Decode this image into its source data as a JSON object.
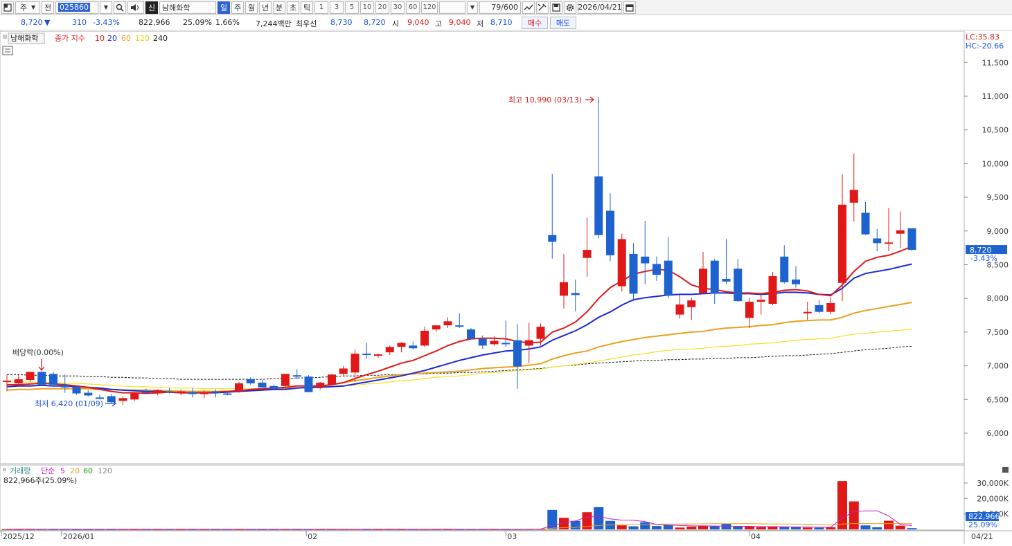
{
  "toolbar": {
    "stock_type": "주",
    "prev_label": "전",
    "code": "025860",
    "market_badge": "신",
    "name": "남해화학",
    "periods": [
      "일",
      "주",
      "월",
      "년",
      "분",
      "초",
      "틱"
    ],
    "active_period": "일",
    "intervals": [
      "1",
      "3",
      "5",
      "10",
      "20",
      "30",
      "60",
      "120"
    ],
    "count": "79/600",
    "date": "2026/04/21",
    "icons": [
      "window-icon",
      "search-icon",
      "speaker-icon",
      "compare-icon",
      "tools-icon",
      "save-icon",
      "gear-icon",
      "calendar-icon"
    ]
  },
  "quote": {
    "price": "8,720",
    "direction_arrow": "▼",
    "change": "310",
    "change_rate": "-3.43%",
    "volume": "822,966",
    "volume_rate": "25.09%",
    "turnover": "1.66%",
    "amount": "7,244백만",
    "best_ask_label": "최우선",
    "best_ask": "8,730",
    "best_bid": "8,720",
    "open_label": "시",
    "open": "9,040",
    "high_label": "고",
    "high": "9,040",
    "low_label": "저",
    "low": "8,710",
    "buy_label": "매수",
    "sell_label": "매도"
  },
  "price_panel": {
    "name_label": "남해화학",
    "indicator_label": "종가 지수",
    "ma_labels": [
      "10",
      "20",
      "60",
      "120",
      "240"
    ],
    "ma_colors": [
      "#e01818",
      "#1a28d0",
      "#e8a020",
      "#f5e020",
      "#111111"
    ],
    "lc": "LC:35.83",
    "hc": "HC:-20.66",
    "current_price_tag": "8,720",
    "current_change_tag": "-3.43%",
    "high_annotation": "최고 10,990 (03/13)",
    "low_annotation": "최저 6,420 (01/09)",
    "dividend_annotation": "배당락(0.00%)",
    "up_color": "#e01818",
    "down_color": "#1e62d0"
  },
  "volume_panel": {
    "title": "거래량",
    "ma_label": "단순",
    "ma_periods": [
      "5",
      "20",
      "60",
      "120"
    ],
    "ma_colors": [
      "#c020c0",
      "#e8a020",
      "#20a020",
      "#888888"
    ],
    "info": "822,966주(25.09%)",
    "current_volume_tag": "822,966",
    "current_rate_tag": "25.09%"
  },
  "x_axis": {
    "labels": [
      "2025/12",
      "2026/01",
      "02",
      "03",
      "04",
      "04/21"
    ]
  },
  "chart_data": {
    "type": "candlestick",
    "price_axis": {
      "ticks": [
        6000,
        6500,
        7000,
        7500,
        8000,
        8500,
        9000,
        9500,
        10000,
        10500,
        11000,
        11500
      ],
      "tick_labels": [
        "6,000",
        "6,500",
        "7,000",
        "7,500",
        "8,000",
        "8,500",
        "9,000",
        "9,500",
        "10,000",
        "10,500",
        "11,000",
        "11,500"
      ]
    },
    "volume_axis": {
      "ticks": [
        10000,
        20000,
        30000
      ],
      "tick_labels": [
        "10,000K",
        "20,000K",
        "30,000K"
      ]
    },
    "candles": [
      {
        "o": 6760,
        "h": 6870,
        "l": 6620,
        "c": 6780
      },
      {
        "o": 6740,
        "h": 6880,
        "l": 6700,
        "c": 6800
      },
      {
        "o": 6790,
        "h": 6900,
        "l": 6760,
        "c": 6910
      },
      {
        "o": 6910,
        "h": 6920,
        "l": 6700,
        "c": 6720
      },
      {
        "o": 6880,
        "h": 6910,
        "l": 6700,
        "c": 6720
      },
      {
        "o": 6720,
        "h": 6870,
        "l": 6600,
        "c": 6680
      },
      {
        "o": 6690,
        "h": 6700,
        "l": 6570,
        "c": 6590
      },
      {
        "o": 6600,
        "h": 6640,
        "l": 6540,
        "c": 6560
      },
      {
        "o": 6530,
        "h": 6570,
        "l": 6500,
        "c": 6520
      },
      {
        "o": 6550,
        "h": 6580,
        "l": 6440,
        "c": 6460
      },
      {
        "o": 6480,
        "h": 6540,
        "l": 6420,
        "c": 6520
      },
      {
        "o": 6500,
        "h": 6600,
        "l": 6480,
        "c": 6600
      },
      {
        "o": 6620,
        "h": 6660,
        "l": 6580,
        "c": 6600
      },
      {
        "o": 6590,
        "h": 6650,
        "l": 6560,
        "c": 6640
      },
      {
        "o": 6620,
        "h": 6670,
        "l": 6590,
        "c": 6610
      },
      {
        "o": 6600,
        "h": 6650,
        "l": 6560,
        "c": 6620
      },
      {
        "o": 6610,
        "h": 6670,
        "l": 6530,
        "c": 6580
      },
      {
        "o": 6580,
        "h": 6640,
        "l": 6520,
        "c": 6610
      },
      {
        "o": 6620,
        "h": 6650,
        "l": 6530,
        "c": 6600
      },
      {
        "o": 6590,
        "h": 6620,
        "l": 6560,
        "c": 6580
      },
      {
        "o": 6620,
        "h": 6760,
        "l": 6600,
        "c": 6740
      },
      {
        "o": 6800,
        "h": 6830,
        "l": 6720,
        "c": 6740
      },
      {
        "o": 6750,
        "h": 6790,
        "l": 6650,
        "c": 6680
      },
      {
        "o": 6700,
        "h": 6720,
        "l": 6640,
        "c": 6660
      },
      {
        "o": 6700,
        "h": 6880,
        "l": 6690,
        "c": 6880
      },
      {
        "o": 6860,
        "h": 6950,
        "l": 6800,
        "c": 6840
      },
      {
        "o": 6840,
        "h": 6860,
        "l": 6610,
        "c": 6610
      },
      {
        "o": 6680,
        "h": 6760,
        "l": 6650,
        "c": 6750
      },
      {
        "o": 6720,
        "h": 6880,
        "l": 6710,
        "c": 6870
      },
      {
        "o": 6880,
        "h": 7000,
        "l": 6860,
        "c": 6960
      },
      {
        "o": 6900,
        "h": 7240,
        "l": 6760,
        "c": 7180
      },
      {
        "o": 7180,
        "h": 7340,
        "l": 7100,
        "c": 7160
      },
      {
        "o": 7160,
        "h": 7180,
        "l": 7120,
        "c": 7170
      },
      {
        "o": 7200,
        "h": 7300,
        "l": 7160,
        "c": 7280
      },
      {
        "o": 7280,
        "h": 7350,
        "l": 7200,
        "c": 7340
      },
      {
        "o": 7300,
        "h": 7360,
        "l": 7240,
        "c": 7260
      },
      {
        "o": 7300,
        "h": 7580,
        "l": 7280,
        "c": 7520
      },
      {
        "o": 7540,
        "h": 7600,
        "l": 7500,
        "c": 7600
      },
      {
        "o": 7600,
        "h": 7720,
        "l": 7560,
        "c": 7660
      },
      {
        "o": 7600,
        "h": 7780,
        "l": 7560,
        "c": 7580
      },
      {
        "o": 7540,
        "h": 7560,
        "l": 7390,
        "c": 7400
      },
      {
        "o": 7400,
        "h": 7450,
        "l": 7250,
        "c": 7300
      },
      {
        "o": 7320,
        "h": 7440,
        "l": 7300,
        "c": 7370
      },
      {
        "o": 7340,
        "h": 7670,
        "l": 7280,
        "c": 7320
      },
      {
        "o": 7380,
        "h": 7620,
        "l": 6660,
        "c": 6990
      },
      {
        "o": 7300,
        "h": 7640,
        "l": 7040,
        "c": 7380
      },
      {
        "o": 7400,
        "h": 7630,
        "l": 7300,
        "c": 7580
      },
      {
        "o": 8940,
        "h": 9850,
        "l": 8590,
        "c": 8840
      },
      {
        "o": 8040,
        "h": 8660,
        "l": 7850,
        "c": 8240
      },
      {
        "o": 8080,
        "h": 8280,
        "l": 7810,
        "c": 8050
      },
      {
        "o": 8600,
        "h": 9200,
        "l": 8320,
        "c": 8720
      },
      {
        "o": 9810,
        "h": 10990,
        "l": 8890,
        "c": 8940
      },
      {
        "o": 9300,
        "h": 9560,
        "l": 8550,
        "c": 8640
      },
      {
        "o": 8180,
        "h": 8960,
        "l": 8100,
        "c": 8880
      },
      {
        "o": 8660,
        "h": 8820,
        "l": 7960,
        "c": 8070
      },
      {
        "o": 8620,
        "h": 9150,
        "l": 8210,
        "c": 8520
      },
      {
        "o": 8510,
        "h": 8620,
        "l": 8260,
        "c": 8350
      },
      {
        "o": 8560,
        "h": 8910,
        "l": 8000,
        "c": 8040
      },
      {
        "o": 7760,
        "h": 8050,
        "l": 7700,
        "c": 7910
      },
      {
        "o": 7870,
        "h": 8010,
        "l": 7680,
        "c": 7970
      },
      {
        "o": 8080,
        "h": 8690,
        "l": 8070,
        "c": 8440
      },
      {
        "o": 8560,
        "h": 8590,
        "l": 7920,
        "c": 8070
      },
      {
        "o": 8290,
        "h": 8880,
        "l": 8210,
        "c": 8250
      },
      {
        "o": 8440,
        "h": 8580,
        "l": 7950,
        "c": 7960
      },
      {
        "o": 7710,
        "h": 8010,
        "l": 7560,
        "c": 7950
      },
      {
        "o": 7950,
        "h": 8050,
        "l": 7760,
        "c": 7980
      },
      {
        "o": 7920,
        "h": 8390,
        "l": 7900,
        "c": 8330
      },
      {
        "o": 8620,
        "h": 8790,
        "l": 8220,
        "c": 8240
      },
      {
        "o": 8280,
        "h": 8480,
        "l": 8160,
        "c": 8210
      },
      {
        "o": 7800,
        "h": 7950,
        "l": 7680,
        "c": 7800
      },
      {
        "o": 7900,
        "h": 7980,
        "l": 7780,
        "c": 7800
      },
      {
        "o": 7800,
        "h": 8020,
        "l": 7760,
        "c": 7930
      },
      {
        "o": 8230,
        "h": 9840,
        "l": 7960,
        "c": 9390
      },
      {
        "o": 9420,
        "h": 10150,
        "l": 9140,
        "c": 9610
      },
      {
        "o": 9270,
        "h": 9430,
        "l": 8940,
        "c": 8950
      },
      {
        "o": 8890,
        "h": 9030,
        "l": 8700,
        "c": 8820
      },
      {
        "o": 8820,
        "h": 9340,
        "l": 8700,
        "c": 8830
      },
      {
        "o": 8960,
        "h": 9290,
        "l": 8750,
        "c": 9010
      },
      {
        "o": 9040,
        "h": 9040,
        "l": 8710,
        "c": 8720
      }
    ],
    "ma10": [
      6720,
      6720,
      6730,
      6740,
      6730,
      6720,
      6700,
      6680,
      6650,
      6620,
      6600,
      6600,
      6590,
      6600,
      6610,
      6600,
      6600,
      6600,
      6610,
      6620,
      6630,
      6650,
      6660,
      6670,
      6680,
      6700,
      6700,
      6700,
      6720,
      6750,
      6810,
      6870,
      6920,
      6980,
      7040,
      7080,
      7150,
      7220,
      7300,
      7360,
      7400,
      7410,
      7410,
      7400,
      7360,
      7340,
      7350,
      7500,
      7560,
      7650,
      7800,
      8000,
      8160,
      8260,
      8360,
      8400,
      8430,
      8420,
      8320,
      8200,
      8150,
      8130,
      8100,
      8080,
      8080,
      8070,
      8090,
      8120,
      8130,
      8110,
      8060,
      8040,
      8200,
      8400,
      8550,
      8610,
      8640,
      8700,
      8770
    ],
    "ma20": [
      6690,
      6700,
      6700,
      6710,
      6700,
      6700,
      6690,
      6680,
      6670,
      6650,
      6640,
      6630,
      6620,
      6620,
      6610,
      6600,
      6600,
      6600,
      6600,
      6610,
      6620,
      6630,
      6640,
      6650,
      6650,
      6670,
      6680,
      6680,
      6690,
      6700,
      6730,
      6760,
      6790,
      6820,
      6850,
      6890,
      6930,
      6980,
      7030,
      7080,
      7120,
      7160,
      7190,
      7220,
      7230,
      7250,
      7280,
      7380,
      7450,
      7520,
      7610,
      7720,
      7800,
      7900,
      7980,
      8010,
      8030,
      8050,
      8060,
      8060,
      8070,
      8080,
      8080,
      8070,
      8070,
      8060,
      8070,
      8090,
      8090,
      8080,
      8060,
      8050,
      8150,
      8300,
      8370,
      8400,
      8430,
      8470,
      8510
    ],
    "ma60": [
      6640,
      6650,
      6650,
      6660,
      6660,
      6660,
      6660,
      6660,
      6650,
      6650,
      6640,
      6640,
      6640,
      6630,
      6630,
      6620,
      6620,
      6620,
      6620,
      6620,
      6630,
      6630,
      6640,
      6650,
      6660,
      6670,
      6680,
      6690,
      6720,
      6750,
      6780,
      6800,
      6830,
      6850,
      6870,
      6880,
      6890,
      6900,
      6910,
      6920,
      6940,
      6960,
      6970,
      6980,
      6990,
      7010,
      7030,
      7100,
      7150,
      7190,
      7220,
      7280,
      7320,
      7360,
      7390,
      7420,
      7440,
      7460,
      7480,
      7500,
      7510,
      7540,
      7560,
      7570,
      7580,
      7600,
      7610,
      7640,
      7660,
      7670,
      7680,
      7680,
      7720,
      7780,
      7820,
      7850,
      7880,
      7910,
      7940
    ],
    "ma120": [
      6760,
      6760,
      6760,
      6750,
      6750,
      6740,
      6740,
      6730,
      6720,
      6710,
      6700,
      6690,
      6690,
      6680,
      6670,
      6670,
      6670,
      6660,
      6660,
      6660,
      6660,
      6660,
      6660,
      6670,
      6670,
      6670,
      6680,
      6680,
      6690,
      6700,
      6710,
      6730,
      6740,
      6760,
      6780,
      6790,
      6810,
      6830,
      6840,
      6850,
      6870,
      6890,
      6900,
      6910,
      6930,
      6940,
      6950,
      6980,
      7000,
      7020,
      7040,
      7070,
      7100,
      7130,
      7160,
      7180,
      7210,
      7230,
      7240,
      7250,
      7260,
      7280,
      7290,
      7300,
      7320,
      7330,
      7340,
      7360,
      7380,
      7390,
      7400,
      7410,
      7440,
      7470,
      7480,
      7500,
      7510,
      7530,
      7540
    ],
    "ma240": [
      6870,
      6870,
      6860,
      6860,
      6850,
      6850,
      6850,
      6840,
      6840,
      6830,
      6830,
      6820,
      6820,
      6810,
      6810,
      6800,
      6800,
      6800,
      6800,
      6800,
      6800,
      6800,
      6800,
      6810,
      6810,
      6820,
      6820,
      6830,
      6840,
      6850,
      6850,
      6860,
      6860,
      6870,
      6870,
      6880,
      6880,
      6890,
      6890,
      6900,
      6900,
      6910,
      6920,
      6930,
      6940,
      6950,
      6960,
      6980,
      7000,
      7010,
      7030,
      7040,
      7050,
      7060,
      7070,
      7080,
      7080,
      7090,
      7090,
      7100,
      7100,
      7110,
      7110,
      7120,
      7120,
      7130,
      7140,
      7150,
      7150,
      7160,
      7170,
      7180,
      7200,
      7220,
      7240,
      7250,
      7260,
      7280,
      7290
    ],
    "volumes": [
      200,
      150,
      180,
      200,
      150,
      150,
      120,
      100,
      120,
      110,
      130,
      100,
      100,
      100,
      100,
      100,
      80,
      90,
      90,
      80,
      100,
      110,
      90,
      80,
      120,
      110,
      120,
      110,
      120,
      150,
      200,
      100,
      100,
      120,
      100,
      100,
      150,
      110,
      100,
      100,
      120,
      120,
      120,
      130,
      200,
      200,
      250,
      12600,
      7500,
      5500,
      11100,
      14400,
      5500,
      2600,
      2000,
      4600,
      2200,
      2800,
      1200,
      1800,
      2300,
      2200,
      3800,
      1800,
      1800,
      1500,
      1800,
      1600,
      1400,
      1200,
      1100,
      1400,
      31300,
      18100,
      2600,
      1400,
      5600,
      2400,
      823
    ],
    "volume_ma5": [
      160,
      170,
      170,
      175,
      170,
      170,
      165,
      150,
      140,
      130,
      120,
      115,
      110,
      110,
      105,
      100,
      95,
      95,
      95,
      90,
      90,
      95,
      95,
      95,
      100,
      105,
      110,
      110,
      115,
      125,
      140,
      135,
      135,
      140,
      140,
      130,
      125,
      120,
      115,
      110,
      115,
      115,
      115,
      120,
      140,
      155,
      180,
      2650,
      4200,
      5500,
      8000,
      8300,
      6800,
      6000,
      5900,
      5000,
      3200,
      2800,
      2600,
      2300,
      2300,
      2200,
      2100,
      2000,
      2000,
      1800,
      1800,
      1700,
      1600,
      1500,
      1400,
      1400,
      7300,
      11500,
      12000,
      12000,
      8700,
      3200,
      2400
    ],
    "volume_ma20": [
      200,
      195,
      190,
      190,
      185,
      180,
      175,
      170,
      165,
      160,
      155,
      150,
      145,
      140,
      135,
      130,
      125,
      120,
      118,
      115,
      112,
      110,
      108,
      105,
      105,
      105,
      105,
      106,
      107,
      110,
      115,
      115,
      115,
      116,
      116,
      116,
      118,
      118,
      118,
      118,
      120,
      122,
      124,
      126,
      130,
      136,
      142,
      750,
      1100,
      1350,
      1900,
      2600,
      2850,
      2950,
      3050,
      3250,
      3350,
      3450,
      3500,
      3550,
      3600,
      3650,
      3700,
      3700,
      3650,
      3600,
      3550,
      3500,
      3400,
      3300,
      3200,
      3100,
      3450,
      3800,
      3750,
      3700,
      3750,
      3700,
      3650
    ]
  }
}
